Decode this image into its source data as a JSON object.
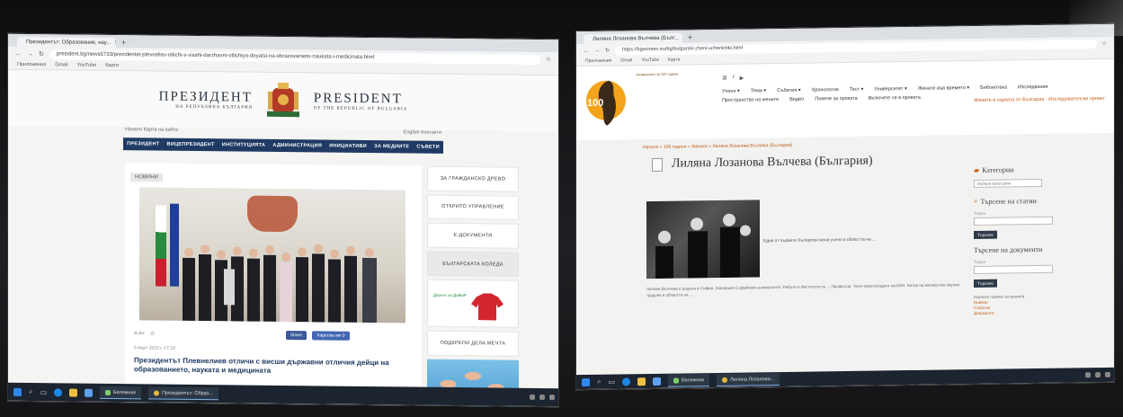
{
  "left_screen": {
    "tab": {
      "title": "Президентът: Образование, нау..."
    },
    "url": "president.bg/news5733/prezidentat-plevneliev-otlichi-s-visshi-darzhavni-otlichiya-deyatsi-na-obrazovanieto-naukata-i-medicinata.html",
    "bookmarks": [
      "Приложения",
      "Gmail",
      "YouTube",
      "Карти"
    ],
    "header": {
      "bg_title": "ПРЕЗИДЕНТ",
      "bg_sub": "НА РЕПУБЛИКА БЪЛГАРИЯ",
      "en_title": "PRESIDENT",
      "en_sub": "OF THE REPUBLIC OF BULGARIA"
    },
    "utility": {
      "left": "Начало  Карта на сайта",
      "right": "English  Контакти"
    },
    "nav": [
      "ПРЕЗИДЕНТ",
      "ВИЦЕПРЕЗИДЕНТ",
      "ИНСТИТУЦИЯТА",
      "АДМИНИСТРАЦИЯ",
      "ИНИЦИАТИВИ",
      "ЗА МЕДИИТЕ",
      "СЪВЕТИ"
    ],
    "news_tag": "НОВИНИ",
    "share_label": "Share",
    "like_label": "Харесва ми 0",
    "date": "5 март 2015 г. 17:18",
    "headline": "Президентът Плевнелиев отличи с висши държавни отличия дейци на образованието, науката и медицината",
    "side": [
      "ЗА ГРАЖДАНСКО ДРЕВО",
      "ОТКРИТО УПРАВЛЕНИЕ",
      "Е-ДОКУМЕНТИ",
      "БЪЛГАРСКАТА КОЛЕДА",
      "ПОДКРЕПИ ДЕЛА МЕЧТА"
    ],
    "side_shirt_caption": "Дарете за ДоМаР",
    "taskbar": [
      "Бележник",
      "Президентът: Образ..."
    ]
  },
  "right_screen": {
    "tab": {
      "title": "Лиляна Лозанова Вълчева (Бълг..."
    },
    "url": "https://bgwomen.eu/bg/bulgarski-zheni-uchenichki.html",
    "bookmarks": [
      "Приложения",
      "Gmail",
      "YouTube",
      "Карти"
    ],
    "logo_text": "Университет за 100 години",
    "socials": [
      "rss",
      "f",
      "yt"
    ],
    "menu": [
      "Учени ▾",
      "Теми ▾",
      "Събития ▾",
      "Хронология",
      "Тест ▾",
      "Университет ▾",
      "Жените във времето ▾",
      "Библиотека",
      "Изследвания",
      "Пространство на жените",
      "Видео",
      "Повече за проекта",
      "Включете се в проекта"
    ],
    "tagline": "Жените в науката от България · Изследователски проект",
    "crumbs": "Начало » 100 години » Жените » Лиляна Лозанова Вълчева (България)",
    "article_title": "Лиляна Лозанова Вълчева (България)",
    "caption": "Една от първите български жени учени в областта на ...",
    "paragraph": "Лиляна Вълчева е родена в София. Завършва Софийския университет. Работи в Института по ... Професор. Член-кореспондент на БАН. Автор на множество научни трудове в областта на ...",
    "sidebar": {
      "categories_title": "Категории",
      "categories_select": "Избери категория",
      "search_title": "Търсене на статии",
      "search_label": "Търси",
      "search_btn": "Търсене",
      "docs_title": "Търсене на документи",
      "docs_label": "Търси",
      "docs_btn": "Търсене",
      "note": "Научете повече за проекта",
      "links": [
        "Новини",
        "Събития",
        "Документи"
      ]
    },
    "taskbar": [
      "Бележник",
      "Лиляна Лозанова..."
    ]
  }
}
